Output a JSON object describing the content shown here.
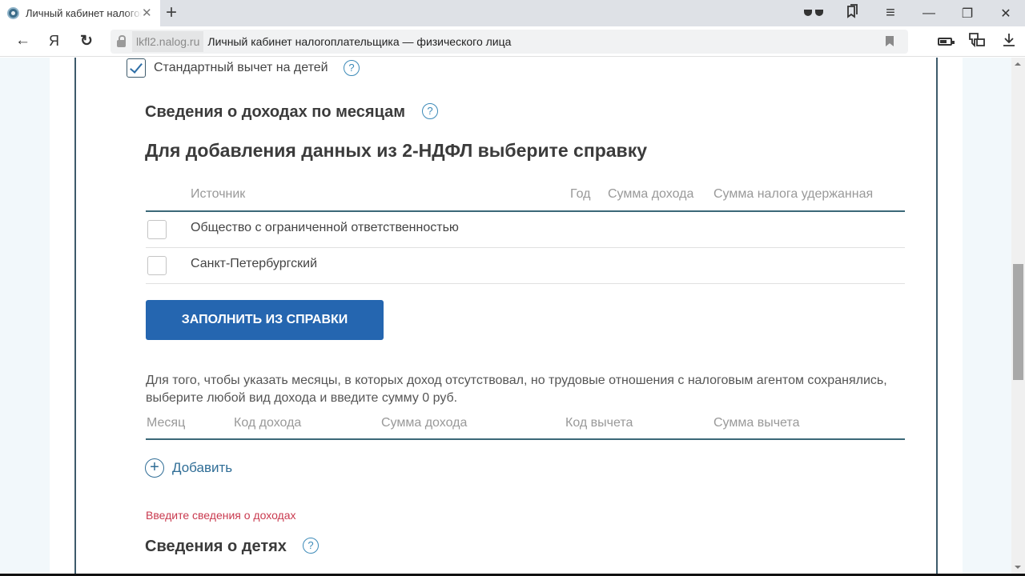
{
  "browser": {
    "tab_title": "Личный кабинет налогоплательщика",
    "tab_close": "✕",
    "new_tab": "+",
    "domain": "lkfl2.nalog.ru",
    "page_title": "Личный кабинет налогоплательщика — физического лица",
    "nav": {
      "back": "←",
      "yandex": "Я",
      "reload": "↻"
    },
    "window": {
      "minimize": "—",
      "restore": "❐",
      "close": "✕",
      "menu": "≡"
    }
  },
  "form": {
    "children_deduction": {
      "label": "Стандартный вычет на детей",
      "checked": true,
      "help": "?"
    },
    "income_by_months": {
      "title": "Сведения о доходах по месяцам",
      "help": "?"
    },
    "ndfl_select": {
      "title": "Для добавления данных из 2-НДФЛ выберите справку",
      "columns": [
        "Источник",
        "Год",
        "Сумма дохода",
        "Сумма налога удержанная"
      ],
      "rows": [
        {
          "source": "Общество с ограниченной ответственностью",
          "year": "",
          "income": "",
          "tax": "",
          "checked": false
        },
        {
          "source": "Санкт-Петербургский",
          "year": "",
          "income": "",
          "tax": "",
          "checked": false
        }
      ],
      "fill_button": "ЗАПОЛНИТЬ ИЗ СПРАВКИ"
    },
    "months_note": "Для того, чтобы указать месяцы, в которых доход отсутствовал, но трудовые отношения с налоговым агентом сохранялись, выберите любой вид дохода и введите сумму 0 руб.",
    "months_table": {
      "columns": [
        "Месяц",
        "Код дохода",
        "Сумма дохода",
        "Код вычета",
        "Сумма вычета"
      ],
      "rows": []
    },
    "add_label": "Добавить",
    "add_icon": "+",
    "error": "Введите сведения о доходах",
    "children_section": {
      "title": "Сведения о детях",
      "help": "?"
    }
  },
  "colors": {
    "primary_button": "#2566b0",
    "accent_link": "#2f6d96",
    "error": "#c93a4f",
    "table_rule": "#3b6878",
    "page_bg": "#f2f8fb"
  }
}
